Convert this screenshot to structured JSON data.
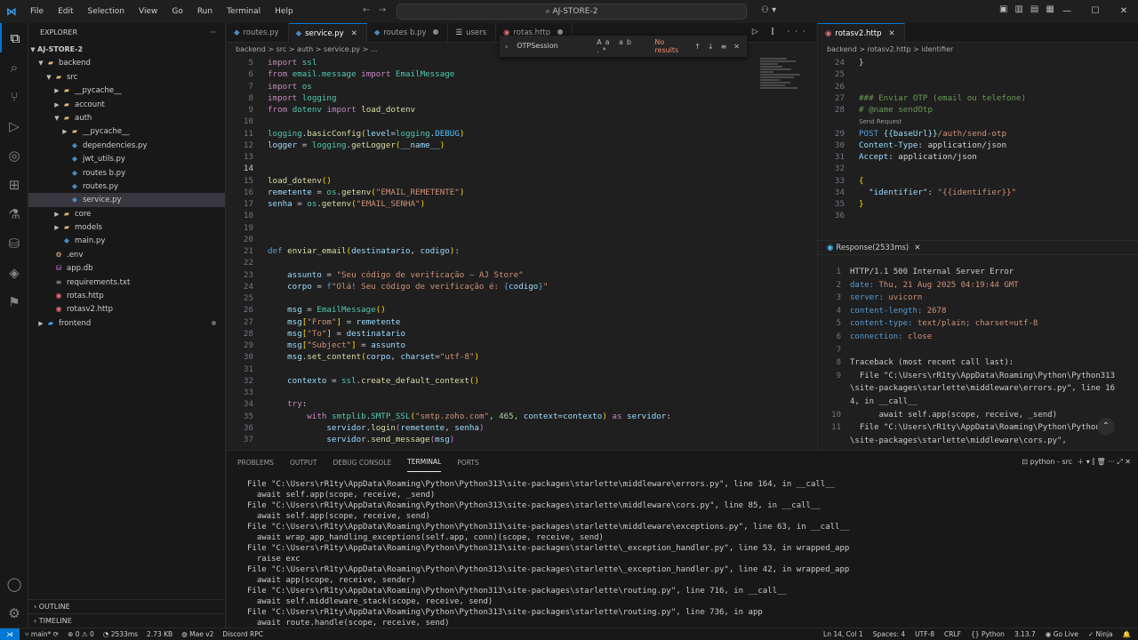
{
  "titlebar": {
    "menu": [
      "File",
      "Edit",
      "Selection",
      "View",
      "Go",
      "Run",
      "Terminal",
      "Help"
    ],
    "search": "AJ-STORE-2"
  },
  "sidebar": {
    "title": "EXPLORER",
    "root": "AJ-STORE-2",
    "items": [
      {
        "label": "backend",
        "depth": 1,
        "kind": "folder",
        "open": true
      },
      {
        "label": "src",
        "depth": 2,
        "kind": "folder",
        "open": true
      },
      {
        "label": "__pycache__",
        "depth": 3,
        "kind": "folder",
        "open": false
      },
      {
        "label": "account",
        "depth": 3,
        "kind": "folder",
        "open": false
      },
      {
        "label": "auth",
        "depth": 3,
        "kind": "folder",
        "open": true
      },
      {
        "label": "__pycache__",
        "depth": 4,
        "kind": "folder",
        "open": false
      },
      {
        "label": "dependencies.py",
        "depth": 4,
        "kind": "py"
      },
      {
        "label": "jwt_utils.py",
        "depth": 4,
        "kind": "py"
      },
      {
        "label": "routes b.py",
        "depth": 4,
        "kind": "py"
      },
      {
        "label": "routes.py",
        "depth": 4,
        "kind": "py"
      },
      {
        "label": "service.py",
        "depth": 4,
        "kind": "py",
        "selected": true
      },
      {
        "label": "core",
        "depth": 3,
        "kind": "folder",
        "open": false
      },
      {
        "label": "models",
        "depth": 3,
        "kind": "folder",
        "open": false
      },
      {
        "label": "main.py",
        "depth": 3,
        "kind": "py"
      },
      {
        "label": ".env",
        "depth": 2,
        "kind": "env"
      },
      {
        "label": "app.db",
        "depth": 2,
        "kind": "db"
      },
      {
        "label": "requirements.txt",
        "depth": 2,
        "kind": "txt"
      },
      {
        "label": "rotas.http",
        "depth": 2,
        "kind": "http"
      },
      {
        "label": "rotasv2.http",
        "depth": 2,
        "kind": "http"
      },
      {
        "label": "frontend",
        "depth": 1,
        "kind": "frontend",
        "open": false,
        "modified": true
      }
    ],
    "outline": "OUTLINE",
    "timeline": "TIMELINE"
  },
  "tabs": [
    {
      "label": "routes.py",
      "active": false
    },
    {
      "label": "service.py",
      "active": true
    },
    {
      "label": "routes b.py",
      "active": false,
      "modified": true
    },
    {
      "label": "users",
      "active": false
    },
    {
      "label": "rotas.http",
      "active": false,
      "modified": true
    }
  ],
  "breadcrumb": "backend > src > auth > service.py > ...",
  "find": {
    "query": "OTPSession",
    "result": "No results"
  },
  "right_tab": "rotasv2.http",
  "right_breadcrumb": "backend > rotasv2.http > identifier",
  "response_tab": "Response(2533ms)",
  "response_lines": [
    {
      "n": "1",
      "k": "HTTP/1.1 500 Internal Server Error",
      "v": ""
    },
    {
      "n": "2",
      "k": "date:",
      "v": " Thu, 21 Aug 2025 04:19:44 GMT"
    },
    {
      "n": "3",
      "k": "server:",
      "v": " uvicorn"
    },
    {
      "n": "4",
      "k": "content-length:",
      "v": " 2678"
    },
    {
      "n": "5",
      "k": "content-type:",
      "v": " text/plain; charset=utf-8"
    },
    {
      "n": "6",
      "k": "connection:",
      "v": " close"
    },
    {
      "n": "7",
      "k": "",
      "v": ""
    },
    {
      "n": "8",
      "k": "Traceback (most recent call last):",
      "v": ""
    },
    {
      "n": "9",
      "k": "  File \"C:\\Users\\rR1ty\\AppData\\Roaming\\Python\\Python313\\site-packages\\starlette\\middleware\\errors.py\", line 164, in __call__",
      "v": ""
    },
    {
      "n": "10",
      "k": "      await self.app(scope, receive, _send)",
      "v": ""
    },
    {
      "n": "11",
      "k": "  File \"C:\\Users\\rR1ty\\AppData\\Roaming\\Python\\Python313\\site-packages\\starlette\\middleware\\cors.py\",",
      "v": ""
    }
  ],
  "panel": {
    "tabs": [
      "PROBLEMS",
      "OUTPUT",
      "DEBUG CONSOLE",
      "TERMINAL",
      "PORTS"
    ],
    "active_tab": "TERMINAL",
    "shell": "python - src",
    "terminal": [
      "File \"C:\\Users\\rR1ty\\AppData\\Roaming\\Python\\Python313\\site-packages\\starlette\\middleware\\errors.py\", line 164, in __call__",
      "  await self.app(scope, receive, _send)",
      "File \"C:\\Users\\rR1ty\\AppData\\Roaming\\Python\\Python313\\site-packages\\starlette\\middleware\\cors.py\", line 85, in __call__",
      "  await self.app(scope, receive, send)",
      "File \"C:\\Users\\rR1ty\\AppData\\Roaming\\Python\\Python313\\site-packages\\starlette\\middleware\\exceptions.py\", line 63, in __call__",
      "  await wrap_app_handling_exceptions(self.app, conn)(scope, receive, send)",
      "File \"C:\\Users\\rR1ty\\AppData\\Roaming\\Python\\Python313\\site-packages\\starlette\\_exception_handler.py\", line 53, in wrapped_app",
      "  raise exc",
      "File \"C:\\Users\\rR1ty\\AppData\\Roaming\\Python\\Python313\\site-packages\\starlette\\_exception_handler.py\", line 42, in wrapped_app",
      "  await app(scope, receive, sender)",
      "File \"C:\\Users\\rR1ty\\AppData\\Roaming\\Python\\Python313\\site-packages\\starlette\\routing.py\", line 716, in __call__",
      "  await self.middleware_stack(scope, receive, send)",
      "File \"C:\\Users\\rR1ty\\AppData\\Roaming\\Python\\Python313\\site-packages\\starlette\\routing.py\", line 736, in app",
      "  await route.handle(scope, receive, send)"
    ]
  },
  "status": {
    "branch": "main*",
    "errors": "0",
    "warnings": "0",
    "time": "2533ms",
    "size": "2.73 KB",
    "env": "Mae v2",
    "discord": "Discord RPC",
    "position": "Ln 14, Col 1",
    "spaces": "Spaces: 4",
    "encoding": "UTF-8",
    "eol": "CRLF",
    "language": "Python",
    "version": "3.13.7",
    "golive": "Go Live",
    "ninja": "Ninja"
  }
}
